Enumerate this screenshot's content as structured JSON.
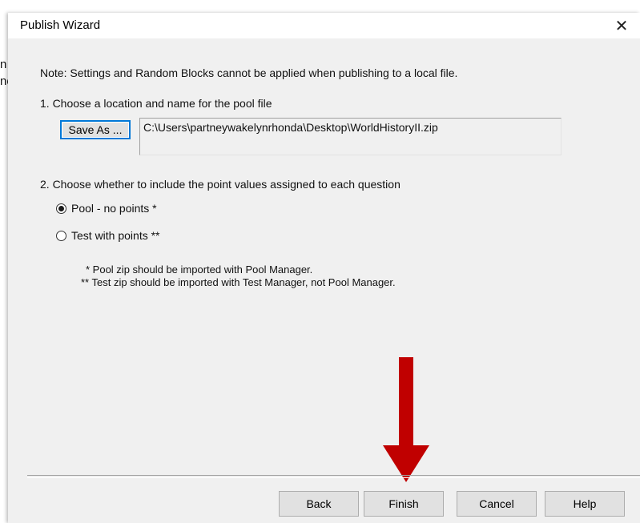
{
  "background_window": {
    "fragment_1": "n",
    "fragment_2": "ne"
  },
  "window": {
    "title": "Publish Wizard",
    "close_glyph": "✕"
  },
  "note": "Note: Settings and Random Blocks cannot be applied when publishing to a local file.",
  "step1": {
    "label": "1.  Choose a location and name for the pool file",
    "save_as_label": "Save As ...",
    "path": "C:\\Users\\partneywakelynrhonda\\Desktop\\WorldHistoryII.zip"
  },
  "step2": {
    "label": "2.  Choose whether to include the point values assigned to each question",
    "options": [
      {
        "label": "Pool - no points *",
        "selected": true
      },
      {
        "label": "Test with points **",
        "selected": false
      }
    ],
    "footnote_1": "* Pool zip should be imported with Pool Manager.",
    "footnote_2": "** Test zip should be imported with Test Manager, not Pool Manager."
  },
  "buttons": {
    "back": "Back",
    "finish": "Finish",
    "cancel": "Cancel",
    "help": "Help"
  },
  "annotation": {
    "arrow_color": "#c00000",
    "arrow_icon": "down-arrow-icon"
  }
}
